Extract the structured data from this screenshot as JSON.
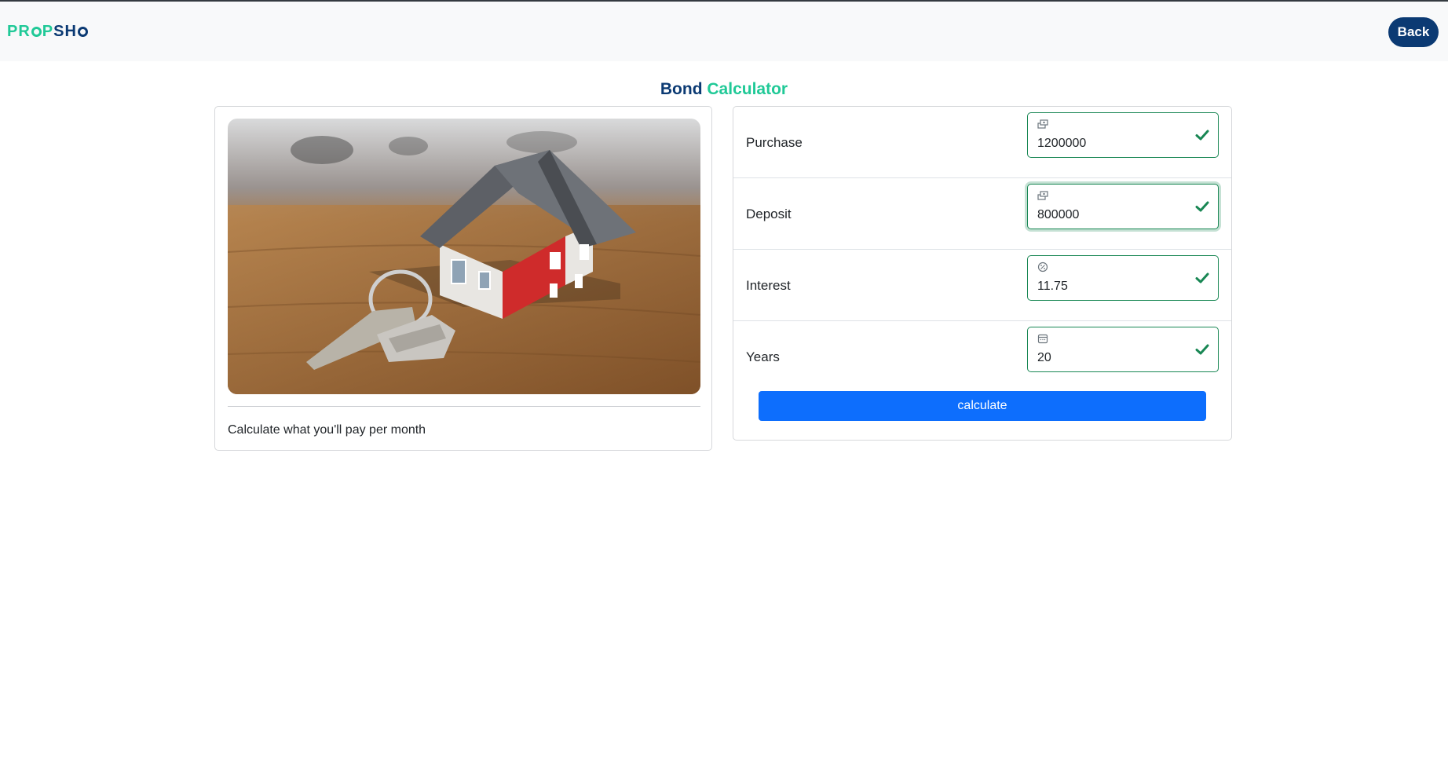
{
  "app": {
    "logo_parts": [
      "PR",
      "P",
      "SH",
      ""
    ],
    "back_label": "Back"
  },
  "title": {
    "part1": "Bond",
    "part2": "Calculator"
  },
  "info_card": {
    "caption": "Calculate what you'll pay per month"
  },
  "form": {
    "fields": [
      {
        "label": "Purchase",
        "value": "1200000",
        "icon": "money-icon",
        "valid": true
      },
      {
        "label": "Deposit",
        "value": "800000",
        "icon": "money-icon",
        "valid": true,
        "focused": true
      },
      {
        "label": "Interest",
        "value": "11.75",
        "icon": "percent-icon",
        "valid": true
      },
      {
        "label": "Years",
        "value": "20",
        "icon": "calendar-icon",
        "valid": true
      }
    ],
    "submit_label": "calculate"
  },
  "colors": {
    "brand_dark": "#0b3a73",
    "brand_green": "#20c997",
    "valid_green": "#198754",
    "primary_blue": "#0d6efd"
  }
}
